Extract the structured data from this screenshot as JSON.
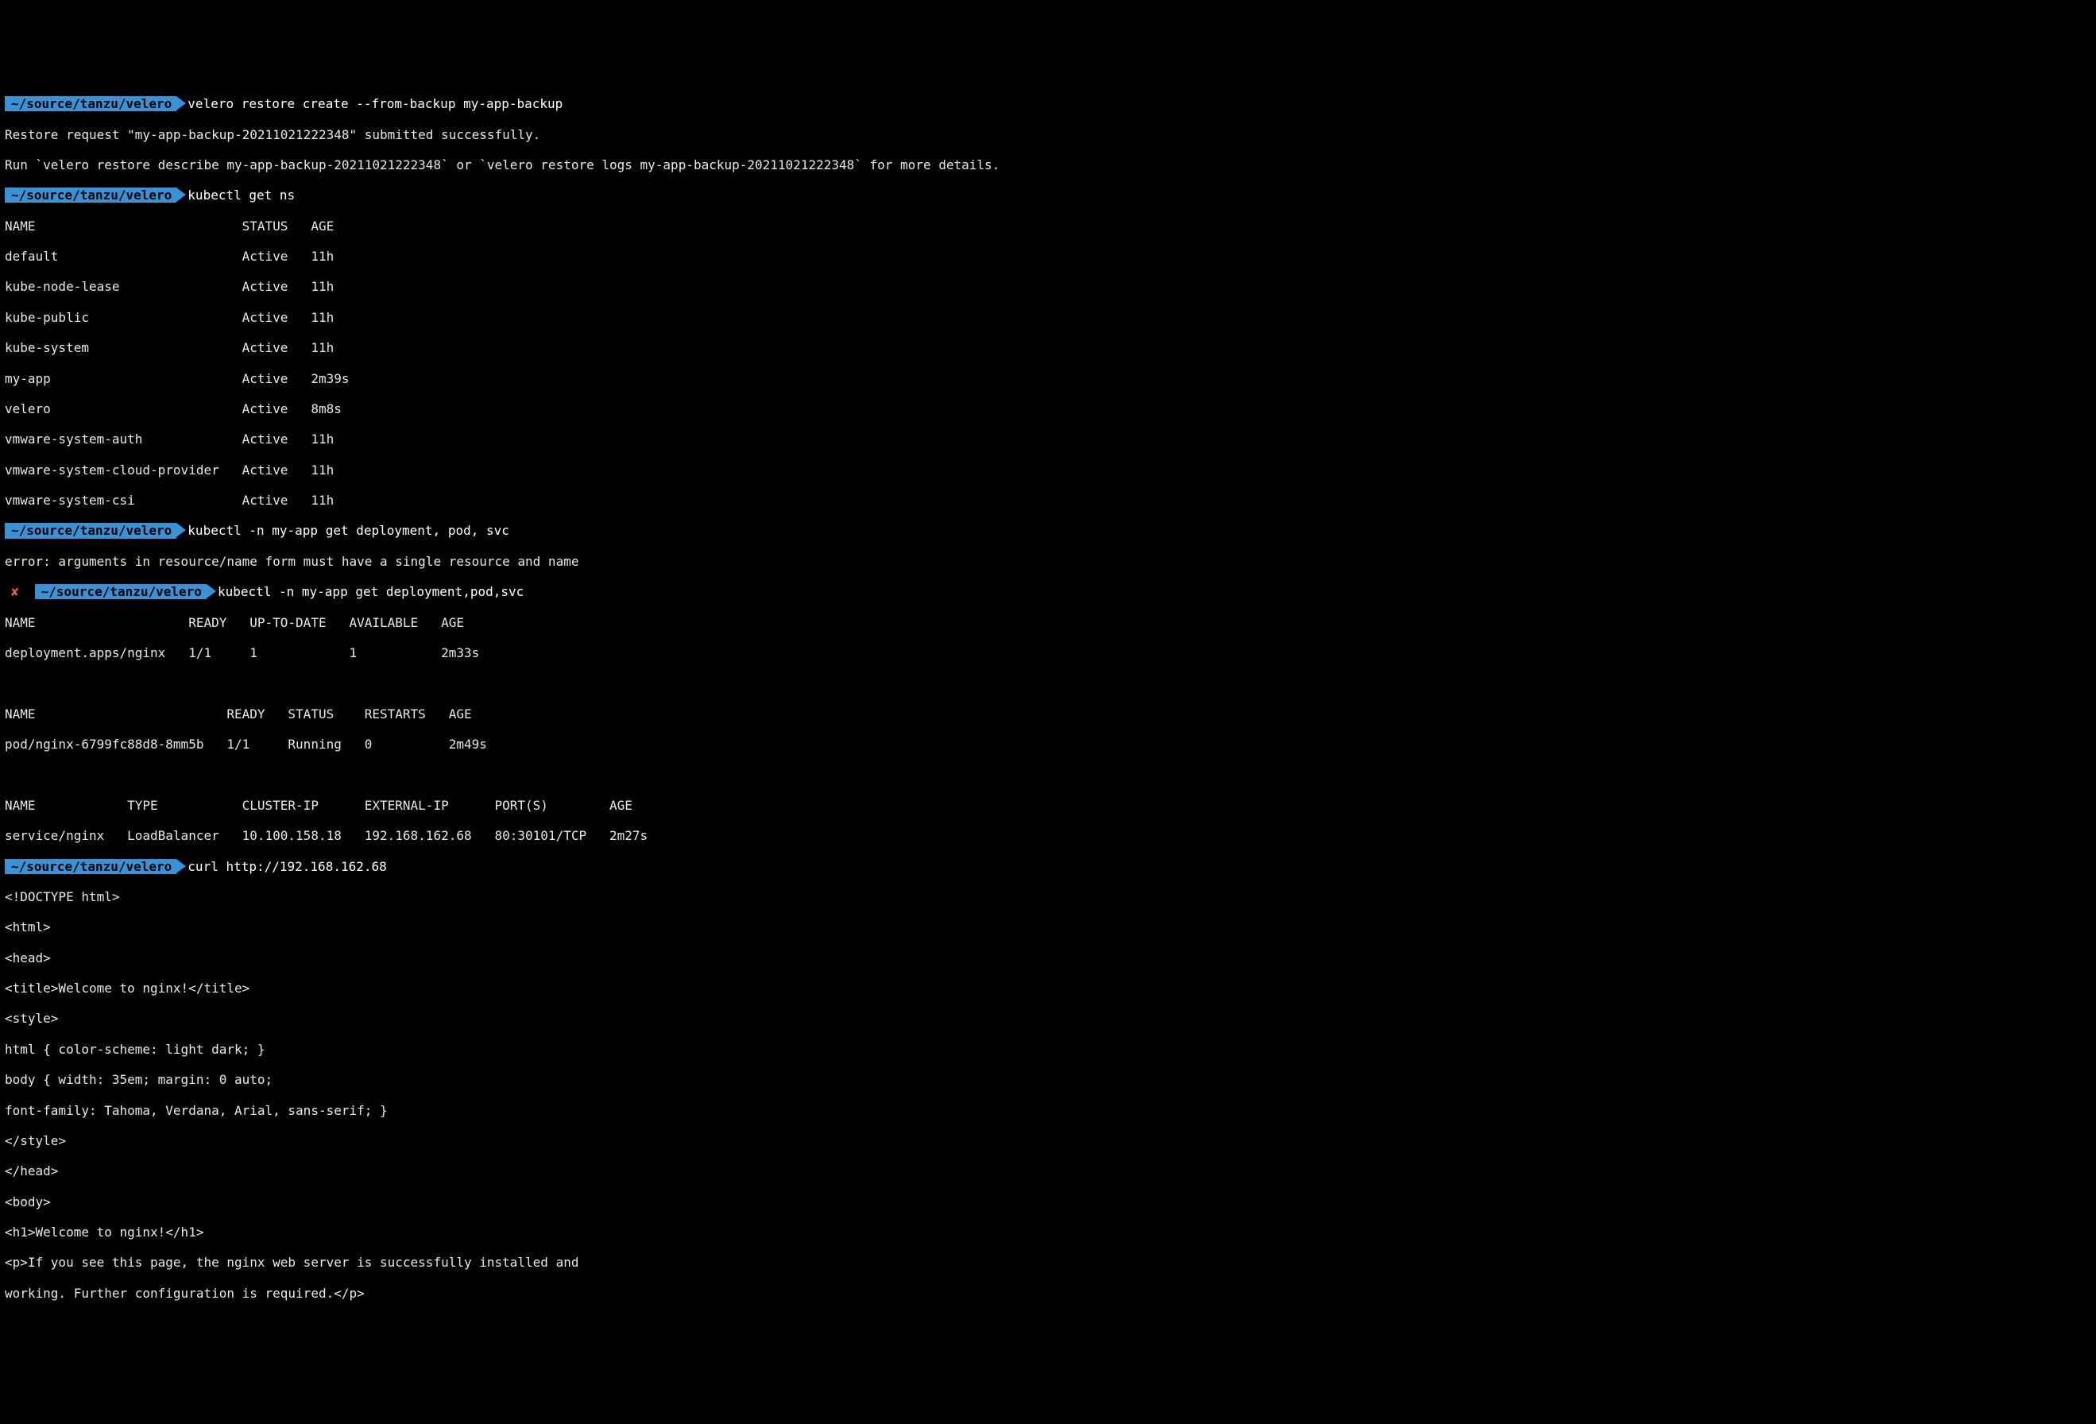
{
  "prompts": {
    "cwd": "~/source/tanzu/velero",
    "err_mark": "✘"
  },
  "cmd1": {
    "command": "velero restore create --from-backup my-app-backup",
    "out1": "Restore request \"my-app-backup-20211021222348\" submitted successfully.",
    "out2": "Run `velero restore describe my-app-backup-20211021222348` or `velero restore logs my-app-backup-20211021222348` for more details."
  },
  "cmd2": {
    "command": "kubectl get ns",
    "header": "NAME                           STATUS   AGE",
    "rows": [
      "default                        Active   11h",
      "kube-node-lease                Active   11h",
      "kube-public                    Active   11h",
      "kube-system                    Active   11h",
      "my-app                         Active   2m39s",
      "velero                         Active   8m8s",
      "vmware-system-auth             Active   11h",
      "vmware-system-cloud-provider   Active   11h",
      "vmware-system-csi              Active   11h"
    ]
  },
  "cmd3": {
    "command": "kubectl -n my-app get deployment, pod, svc",
    "out1": "error: arguments in resource/name form must have a single resource and name"
  },
  "cmd4": {
    "command": "kubectl -n my-app get deployment,pod,svc",
    "dep_header": "NAME                    READY   UP-TO-DATE   AVAILABLE   AGE",
    "dep_row": "deployment.apps/nginx   1/1     1            1           2m33s",
    "pod_header": "NAME                         READY   STATUS    RESTARTS   AGE",
    "pod_row": "pod/nginx-6799fc88d8-8mm5b   1/1     Running   0          2m49s",
    "svc_header": "NAME            TYPE           CLUSTER-IP      EXTERNAL-IP      PORT(S)        AGE",
    "svc_row": "service/nginx   LoadBalancer   10.100.158.18   192.168.162.68   80:30101/TCP   2m27s"
  },
  "cmd5": {
    "command": "curl http://192.168.162.68",
    "lines": [
      "<!DOCTYPE html>",
      "<html>",
      "<head>",
      "<title>Welcome to nginx!</title>",
      "<style>",
      "html { color-scheme: light dark; }",
      "body { width: 35em; margin: 0 auto;",
      "font-family: Tahoma, Verdana, Arial, sans-serif; }",
      "</style>",
      "</head>",
      "<body>",
      "<h1>Welcome to nginx!</h1>",
      "<p>If you see this page, the nginx web server is successfully installed and",
      "working. Further configuration is required.</p>"
    ]
  }
}
